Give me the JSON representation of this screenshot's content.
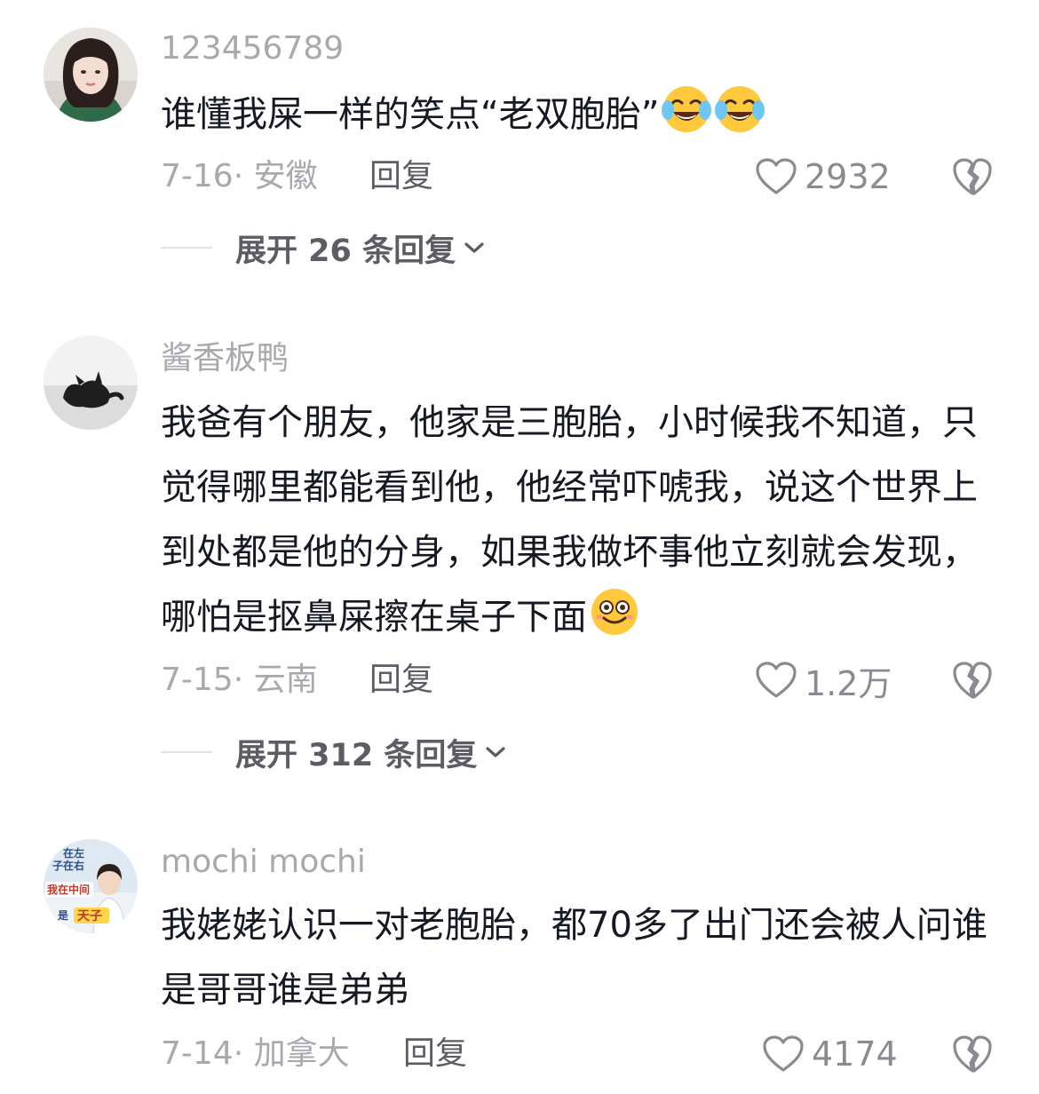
{
  "comments": [
    {
      "username": "123456789",
      "avatar_icon": "avatar-woman-icon",
      "text": "谁懂我屎一样的笑点“老双胞胎”",
      "emojis": [
        "laugh-cry-emoji",
        "laugh-cry-emoji"
      ],
      "date": "7-16",
      "location": "安徽",
      "reply_label": "回复",
      "likes": "2932",
      "expand_label": "展开 26 条回复"
    },
    {
      "username": "酱香板鸭",
      "avatar_icon": "avatar-cat-icon",
      "text": "我爸有个朋友，他家是三胞胎，小时候我不知道，只觉得哪里都能看到他，他经常吓唬我，说这个世界上到处都是他的分身，如果我做坏事他立刻就会发现，哪怕是抠鼻屎擦在桌子下面",
      "emojis": [
        "smile-emoji"
      ],
      "date": "7-15",
      "location": "云南",
      "reply_label": "回复",
      "likes": "1.2万",
      "expand_label": "展开 312 条回复"
    },
    {
      "username": "mochi mochi",
      "avatar_icon": "avatar-meme-icon",
      "avatar_text": [
        "在左",
        "子在右",
        "我在中间",
        "是",
        "天子"
      ],
      "text": "我姥姥认识一对老胞胎，都70多了出门还会被人问谁是哥哥谁是弟弟",
      "emojis": [],
      "date": "7-14",
      "location": "加拿大",
      "reply_label": "回复",
      "likes": "4174"
    }
  ],
  "meta_separator": "· ",
  "icons": {
    "like": "heart-outline-icon",
    "dislike": "broken-heart-icon",
    "expand": "chevron-down-icon"
  },
  "colors": {
    "text_primary": "#161823",
    "text_secondary": "#a8a8ad",
    "text_action": "#5c5d64",
    "emoji_yellow": "#ffc83d"
  }
}
